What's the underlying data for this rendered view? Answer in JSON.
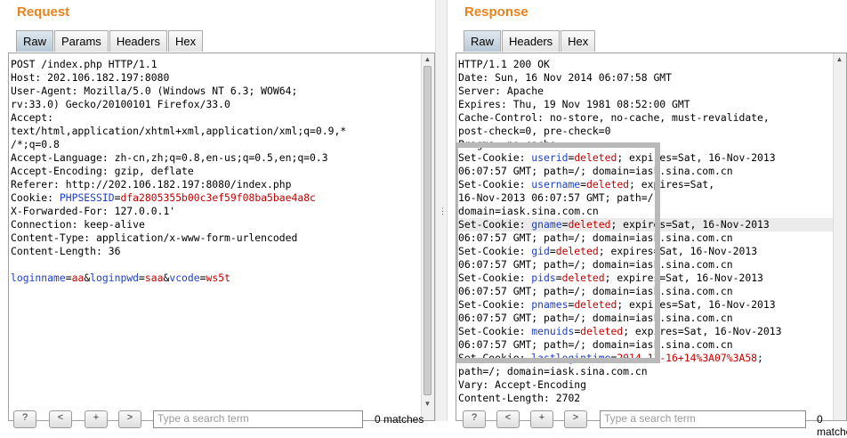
{
  "request": {
    "title": "Request",
    "tabs": [
      "Raw",
      "Params",
      "Headers",
      "Hex"
    ],
    "lines": [
      [
        {
          "t": "POST /index.php HTTP/1.1"
        }
      ],
      [
        {
          "t": "Host: 202.106.182.197:8080"
        }
      ],
      [
        {
          "t": "User-Agent: Mozilla/5.0 (Windows NT 6.3; WOW64;"
        }
      ],
      [
        {
          "t": "rv:33.0) Gecko/20100101 Firefox/33.0"
        }
      ],
      [
        {
          "t": "Accept:"
        }
      ],
      [
        {
          "t": "text/html,application/xhtml+xml,application/xml;q=0.9,*"
        }
      ],
      [
        {
          "t": "/*;q=0.8"
        }
      ],
      [
        {
          "t": "Accept-Language: zh-cn,zh;q=0.8,en-us;q=0.5,en;q=0.3"
        }
      ],
      [
        {
          "t": "Accept-Encoding: gzip, deflate"
        }
      ],
      [
        {
          "t": "Referer: http://202.106.182.197:8080/index.php"
        }
      ],
      [
        {
          "t": "Cookie: "
        },
        {
          "t": "PHPSESSID",
          "c": "k"
        },
        {
          "t": "="
        },
        {
          "t": "dfa2805355b00c3ef59f08ba5bae4a8c",
          "c": "v"
        }
      ],
      [
        {
          "t": "X-Forwarded-For: 127.0.0.1'"
        }
      ],
      [
        {
          "t": "Connection: keep-alive"
        }
      ],
      [
        {
          "t": "Content-Type: application/x-www-form-urlencoded"
        }
      ],
      [
        {
          "t": "Content-Length: 36"
        }
      ],
      [
        {
          "t": ""
        }
      ],
      [
        {
          "t": "loginname",
          "c": "k"
        },
        {
          "t": "="
        },
        {
          "t": "aa",
          "c": "v"
        },
        {
          "t": "&"
        },
        {
          "t": "loginpwd",
          "c": "k"
        },
        {
          "t": "="
        },
        {
          "t": "saa",
          "c": "v"
        },
        {
          "t": "&"
        },
        {
          "t": "vcode",
          "c": "k"
        },
        {
          "t": "="
        },
        {
          "t": "ws5t",
          "c": "v"
        }
      ]
    ],
    "search_placeholder": "Type a search term",
    "matches": "0 matches"
  },
  "response": {
    "title": "Response",
    "tabs": [
      "Raw",
      "Headers",
      "Hex"
    ],
    "lines": [
      [
        {
          "t": "HTTP/1.1 200 OK"
        }
      ],
      [
        {
          "t": "Date: Sun, 16 Nov 2014 06:07:58 GMT"
        }
      ],
      [
        {
          "t": "Server: Apache"
        }
      ],
      [
        {
          "t": "Expires: Thu, 19 Nov 1981 08:52:00 GMT"
        }
      ],
      [
        {
          "t": "Cache-Control: no-store, no-cache, must-revalidate,"
        }
      ],
      [
        {
          "t": "post-check=0, pre-check=0"
        }
      ],
      [
        {
          "t": "Pragma: no-cache"
        }
      ],
      [
        {
          "t": "Set-Cookie: "
        },
        {
          "t": "userid",
          "c": "k"
        },
        {
          "t": "="
        },
        {
          "t": "deleted",
          "c": "v"
        },
        {
          "t": "; expires=Sat, 16-Nov-2013"
        }
      ],
      [
        {
          "t": "06:07:57 GMT; path=/; domain=iask.sina.com.cn"
        }
      ],
      [
        {
          "t": "Set-Cookie: "
        },
        {
          "t": "username",
          "c": "k"
        },
        {
          "t": "="
        },
        {
          "t": "deleted",
          "c": "v"
        },
        {
          "t": "; expires=Sat,"
        }
      ],
      [
        {
          "t": "16-Nov-2013 06:07:57 GMT; path=/;"
        }
      ],
      [
        {
          "t": "domain=iask.sina.com.cn"
        }
      ],
      [
        {
          "t": "Set-Cookie: "
        },
        {
          "t": "gname",
          "c": "k"
        },
        {
          "t": "="
        },
        {
          "t": "deleted",
          "c": "v"
        },
        {
          "t": "; expires=Sat, 16-Nov-2013"
        }
      ],
      [
        {
          "t": "06:07:57 GMT; path=/; domain=iask.sina.com.cn"
        }
      ],
      [
        {
          "t": "Set-Cookie: "
        },
        {
          "t": "gid",
          "c": "k"
        },
        {
          "t": "="
        },
        {
          "t": "deleted",
          "c": "v"
        },
        {
          "t": "; expires=Sat, 16-Nov-2013"
        }
      ],
      [
        {
          "t": "06:07:57 GMT; path=/; domain=iask.sina.com.cn"
        }
      ],
      [
        {
          "t": "Set-Cookie: "
        },
        {
          "t": "pids",
          "c": "k"
        },
        {
          "t": "="
        },
        {
          "t": "deleted",
          "c": "v"
        },
        {
          "t": "; expires=Sat, 16-Nov-2013"
        }
      ],
      [
        {
          "t": "06:07:57 GMT; path=/; domain=iask.sina.com.cn"
        }
      ],
      [
        {
          "t": "Set-Cookie: "
        },
        {
          "t": "pnames",
          "c": "k"
        },
        {
          "t": "="
        },
        {
          "t": "deleted",
          "c": "v"
        },
        {
          "t": "; expires=Sat, 16-Nov-2013"
        }
      ],
      [
        {
          "t": "06:07:57 GMT; path=/; domain=iask.sina.com.cn"
        }
      ],
      [
        {
          "t": "Set-Cookie: "
        },
        {
          "t": "menuids",
          "c": "k"
        },
        {
          "t": "="
        },
        {
          "t": "deleted",
          "c": "v"
        },
        {
          "t": "; expires=Sat, 16-Nov-2013"
        }
      ],
      [
        {
          "t": "06:07:57 GMT; path=/; domain=iask.sina.com.cn"
        }
      ],
      [
        {
          "t": "Set-Cookie: "
        },
        {
          "t": "lastlogintime",
          "c": "k"
        },
        {
          "t": "="
        },
        {
          "t": "2014-11-16+14%3A07%3A58",
          "c": "v"
        },
        {
          "t": ";"
        }
      ],
      [
        {
          "t": "path=/; domain=iask.sina.com.cn"
        }
      ],
      [
        {
          "t": "Vary: Accept-Encoding"
        }
      ],
      [
        {
          "t": "Content-Length: 2702"
        }
      ]
    ],
    "search_placeholder": "Type a search term",
    "matches": "0 matches"
  },
  "toolbar": {
    "help_label": "?",
    "prev_label": "<",
    "add_label": "+",
    "next_label": ">"
  }
}
